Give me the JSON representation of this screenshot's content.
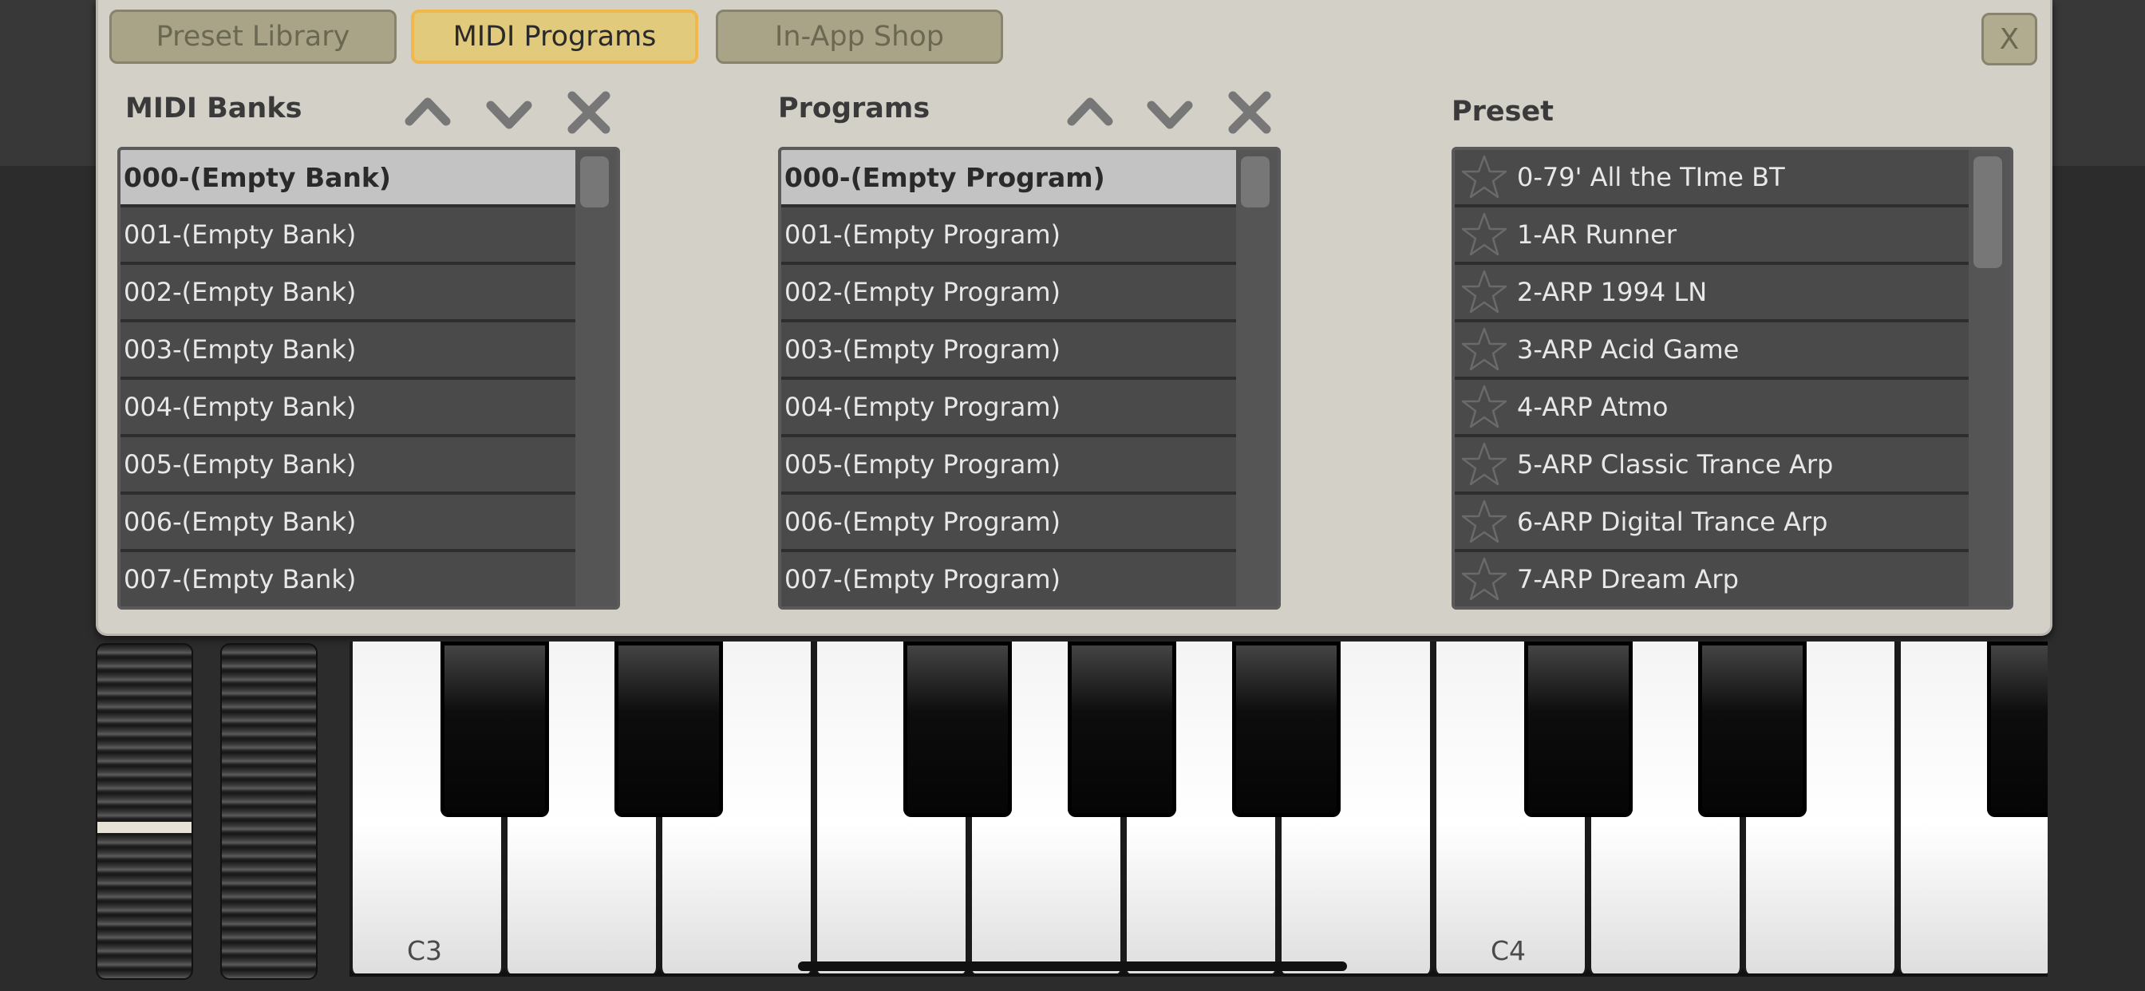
{
  "tabs": [
    {
      "label": "Preset Library",
      "active": false
    },
    {
      "label": "MIDI Programs",
      "active": true
    },
    {
      "label": "In-App Shop",
      "active": false
    }
  ],
  "close_label": "X",
  "midi_banks": {
    "title": "MIDI Banks",
    "items": [
      "000-(Empty Bank)",
      "001-(Empty Bank)",
      "002-(Empty Bank)",
      "003-(Empty Bank)",
      "004-(Empty Bank)",
      "005-(Empty Bank)",
      "006-(Empty Bank)",
      "007-(Empty Bank)"
    ],
    "selected_index": 0
  },
  "programs": {
    "title": "Programs",
    "items": [
      "000-(Empty Program)",
      "001-(Empty Program)",
      "002-(Empty Program)",
      "003-(Empty Program)",
      "004-(Empty Program)",
      "005-(Empty Program)",
      "006-(Empty Program)",
      "007-(Empty Program)"
    ],
    "selected_index": 0
  },
  "preset": {
    "title": "Preset",
    "items": [
      "0-79' All the TIme BT",
      "1-AR Runner",
      "2-ARP 1994 LN",
      "3-ARP Acid Game",
      "4-ARP Atmo",
      "5-ARP Classic Trance Arp",
      "6-ARP Digital Trance Arp",
      "7-ARP Dream Arp"
    ]
  },
  "keyboard": {
    "labels": [
      "C3",
      "C4"
    ]
  },
  "icons": {
    "up": "chevron-up-icon",
    "down": "chevron-down-icon",
    "clear": "close-icon",
    "favorite": "star-outline-icon"
  },
  "colors": {
    "dialog_bg": "#d3d0c7",
    "active_tab": "#e2ca7c",
    "active_tab_border": "#f0b84c",
    "inactive_tab": "#a9a388",
    "list_row": "#4a4a4a",
    "selected_row": "#c3c3c3"
  }
}
